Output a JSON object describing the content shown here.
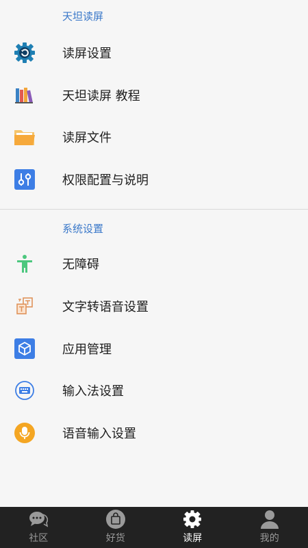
{
  "sections": [
    {
      "title": "天坦读屏",
      "items": [
        {
          "label": "读屏设置",
          "icon": "gear-icon"
        },
        {
          "label": "天坦读屏 教程",
          "icon": "books-icon"
        },
        {
          "label": "读屏文件",
          "icon": "folder-icon"
        },
        {
          "label": "权限配置与说明",
          "icon": "sliders-icon"
        }
      ]
    },
    {
      "title": "系统设置",
      "items": [
        {
          "label": "无障碍",
          "icon": "accessibility-icon"
        },
        {
          "label": "文字转语音设置",
          "icon": "text-to-speech-icon"
        },
        {
          "label": "应用管理",
          "icon": "app-box-icon"
        },
        {
          "label": "输入法设置",
          "icon": "keyboard-icon"
        },
        {
          "label": "语音输入设置",
          "icon": "microphone-icon"
        }
      ]
    }
  ],
  "tabbar": {
    "tabs": [
      {
        "label": "社区",
        "icon": "chat-bubbles-icon",
        "active": false
      },
      {
        "label": "好货",
        "icon": "shopping-bag-icon",
        "active": false
      },
      {
        "label": "读屏",
        "icon": "gear-icon",
        "active": true
      },
      {
        "label": "我的",
        "icon": "person-icon",
        "active": false
      }
    ]
  },
  "colors": {
    "section_title": "#3a78c9",
    "tabbar_background": "#222222",
    "tab_active": "#ffffff",
    "tab_inactive": "#9a9a9a"
  }
}
